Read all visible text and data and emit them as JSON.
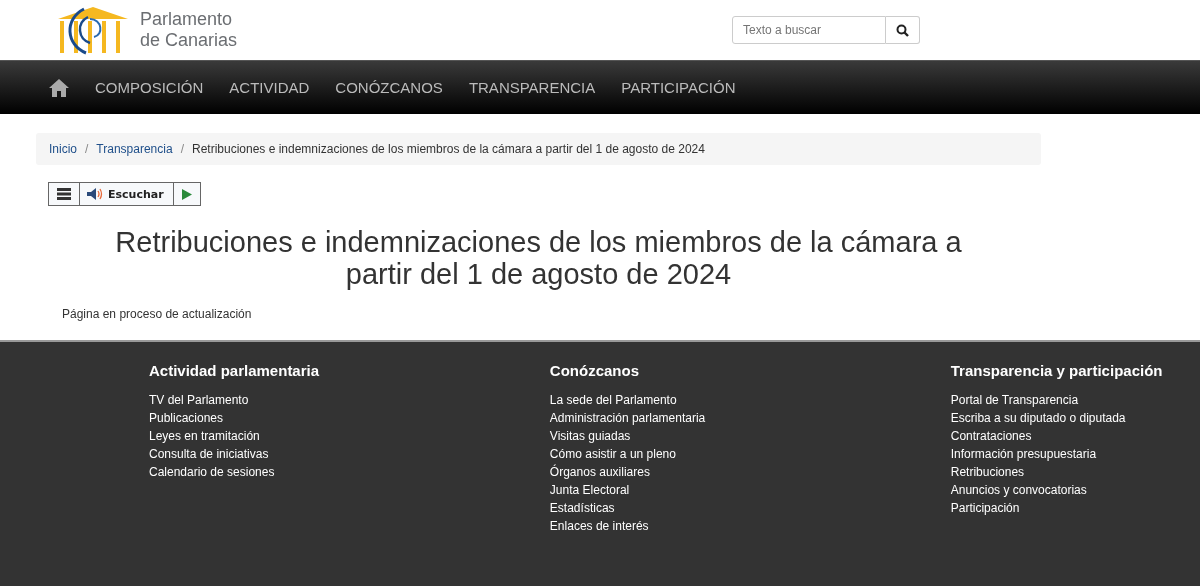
{
  "header": {
    "logo_text": [
      "Parlamento",
      "de Canarias"
    ],
    "search": {
      "placeholder": "Texto a buscar"
    }
  },
  "nav": {
    "items": [
      "COMPOSICIÓN",
      "ACTIVIDAD",
      "CONÓZCANOS",
      "TRANSPARENCIA",
      "PARTICIPACIÓN"
    ]
  },
  "breadcrumb_separator": "/",
  "breadcrumb": [
    "Inicio",
    "Transparencia",
    "Retribuciones e indemnizaciones de los miembros de la cámara a partir del 1 de agosto de 2024"
  ],
  "player": {
    "label": "Escuchar"
  },
  "title": "Retribuciones e indemnizaciones de los miembros de la cámara a partir del 1 de agosto de 2024",
  "body": "Página en proceso de actualización",
  "footer": [
    {
      "heading": "Actividad parlamentaria",
      "links": [
        "TV del Parlamento",
        "Publicaciones",
        "Leyes en tramitación",
        "Consulta de iniciativas",
        "Calendario de sesiones"
      ]
    },
    {
      "heading": "Conózcanos",
      "links": [
        "La sede del Parlamento",
        "Administración parlamentaria",
        "Visitas guiadas",
        "Cómo asistir a un pleno",
        "Órganos auxiliares",
        "Junta Electoral",
        "Estadísticas",
        "Enlaces de interés"
      ]
    },
    {
      "heading": "Transparencia y participación",
      "links": [
        "Portal de Transparencia",
        "Escriba a su diputado o diputada",
        "Contrataciones",
        "Información presupuestaria",
        "Retribuciones",
        "Anuncios y convocatorias",
        "Participación"
      ]
    }
  ]
}
